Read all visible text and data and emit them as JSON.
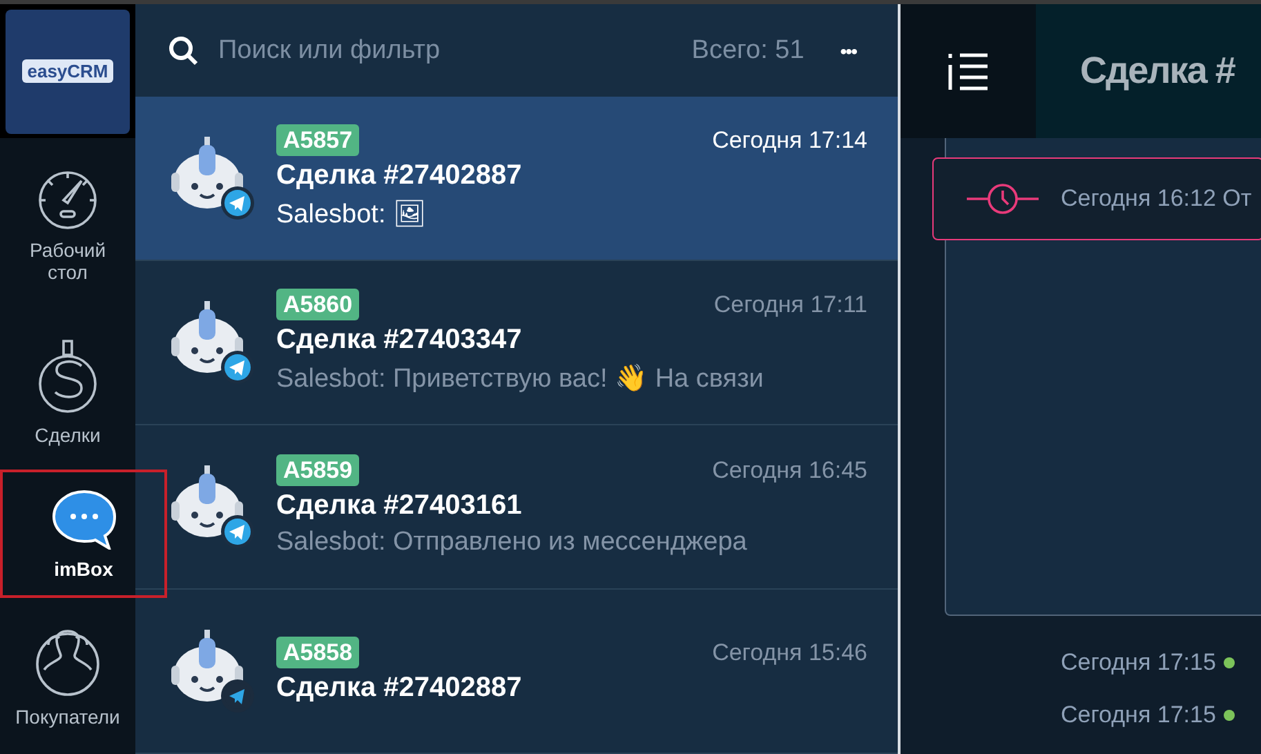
{
  "logo": {
    "text": "easyCRM"
  },
  "nav": [
    {
      "label": "Рабочий стол",
      "kind": "gauge",
      "selected": false
    },
    {
      "label": "Сделки",
      "kind": "dollar",
      "selected": false
    },
    {
      "label": "imBox",
      "kind": "chat",
      "selected": true
    },
    {
      "label": "Покупатели",
      "kind": "people",
      "selected": false
    }
  ],
  "search": {
    "placeholder": "Поиск или фильтр",
    "total": "Всего: 51",
    "menu": "•••"
  },
  "chats": [
    {
      "badge": "A5857",
      "time": "Сегодня 17:14",
      "title": "Сделка #27402887",
      "preview": "Salesbot: 🖼",
      "selected": true
    },
    {
      "badge": "A5860",
      "time": "Сегодня 17:11",
      "title": "Сделка #27403347",
      "preview": "Salesbot: Приветствую вас! 👋 На связи",
      "selected": false
    },
    {
      "badge": "A5859",
      "time": "Сегодня 16:45",
      "title": "Сделка #27403161",
      "preview": "Salesbot: Отправлено из мессенджера",
      "selected": false
    },
    {
      "badge": "A5858",
      "time": "Сегодня 15:46",
      "title": "Сделка #27402887",
      "selected": false
    }
  ],
  "detail": {
    "title": "Сделка #",
    "event": "Сегодня 16:12 От",
    "messages": [
      {
        "time": "Сегодня 17:15",
        "color": "#7cc35a"
      },
      {
        "time": "Сегодня 17:15",
        "color": "#7cc35a"
      }
    ]
  }
}
